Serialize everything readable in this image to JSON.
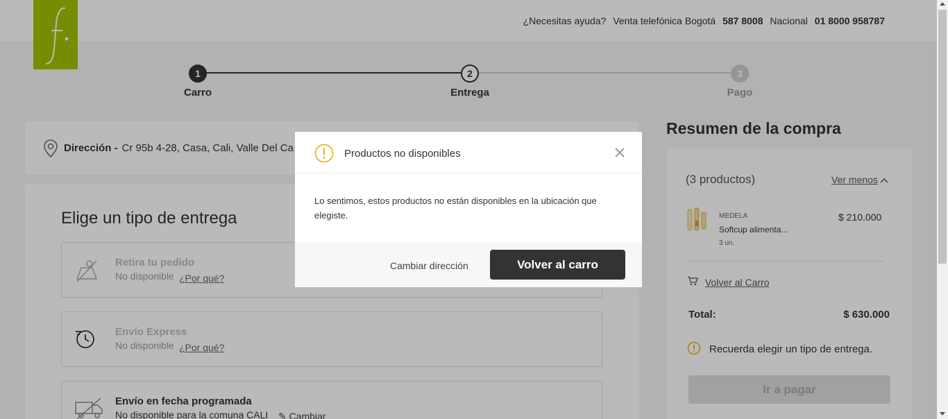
{
  "header": {
    "help_question": "¿Necesitas ayuda?",
    "phone_bogota_label": "Venta telefónica Bogotá",
    "phone_bogota": "587 8008",
    "phone_national_label": "Nacional",
    "phone_national": "01 8000 958787"
  },
  "steps": [
    {
      "number": "1",
      "label": "Carro"
    },
    {
      "number": "2",
      "label": "Entrega"
    },
    {
      "number": "3",
      "label": "Pago"
    }
  ],
  "address": {
    "label": "Dirección -",
    "value": "Cr 95b 4-28, Casa, Cali, Valle Del Ca"
  },
  "delivery": {
    "title": "Elige un tipo de entrega",
    "options": [
      {
        "title": "Retira tu pedido",
        "status": "No disponible",
        "why": "¿Por qué?"
      },
      {
        "title": "Envío Express",
        "status": "No disponible",
        "why": "¿Por qué?"
      },
      {
        "title": "Envío en fecha programada",
        "status": "No disponible para la comuna CALI",
        "change": "Cambiar"
      }
    ]
  },
  "summary": {
    "title": "Resumen de la compra",
    "count": "(3 productos)",
    "toggle": "Ver menos",
    "product": {
      "brand": "MEDELA",
      "name": "Softcup alimenta...",
      "qty": "3 un.",
      "price": "$ 210.000"
    },
    "cart_link": "Volver al Carro",
    "total_label": "Total:",
    "total_value": "$ 630.000",
    "reminder": "Recuerda elegir un tipo de entrega.",
    "pay_button": "Ir a pagar"
  },
  "modal": {
    "title": "Productos no disponibles",
    "message": "Lo sentimos, estos productos no están disponibles en la ubicación que elegiste.",
    "change_address": "Cambiar dirección",
    "back_to_cart": "Volver al carro"
  },
  "colors": {
    "brand_green": "#a5c100",
    "warning_yellow": "#e8b000",
    "dark_button": "#333333"
  }
}
